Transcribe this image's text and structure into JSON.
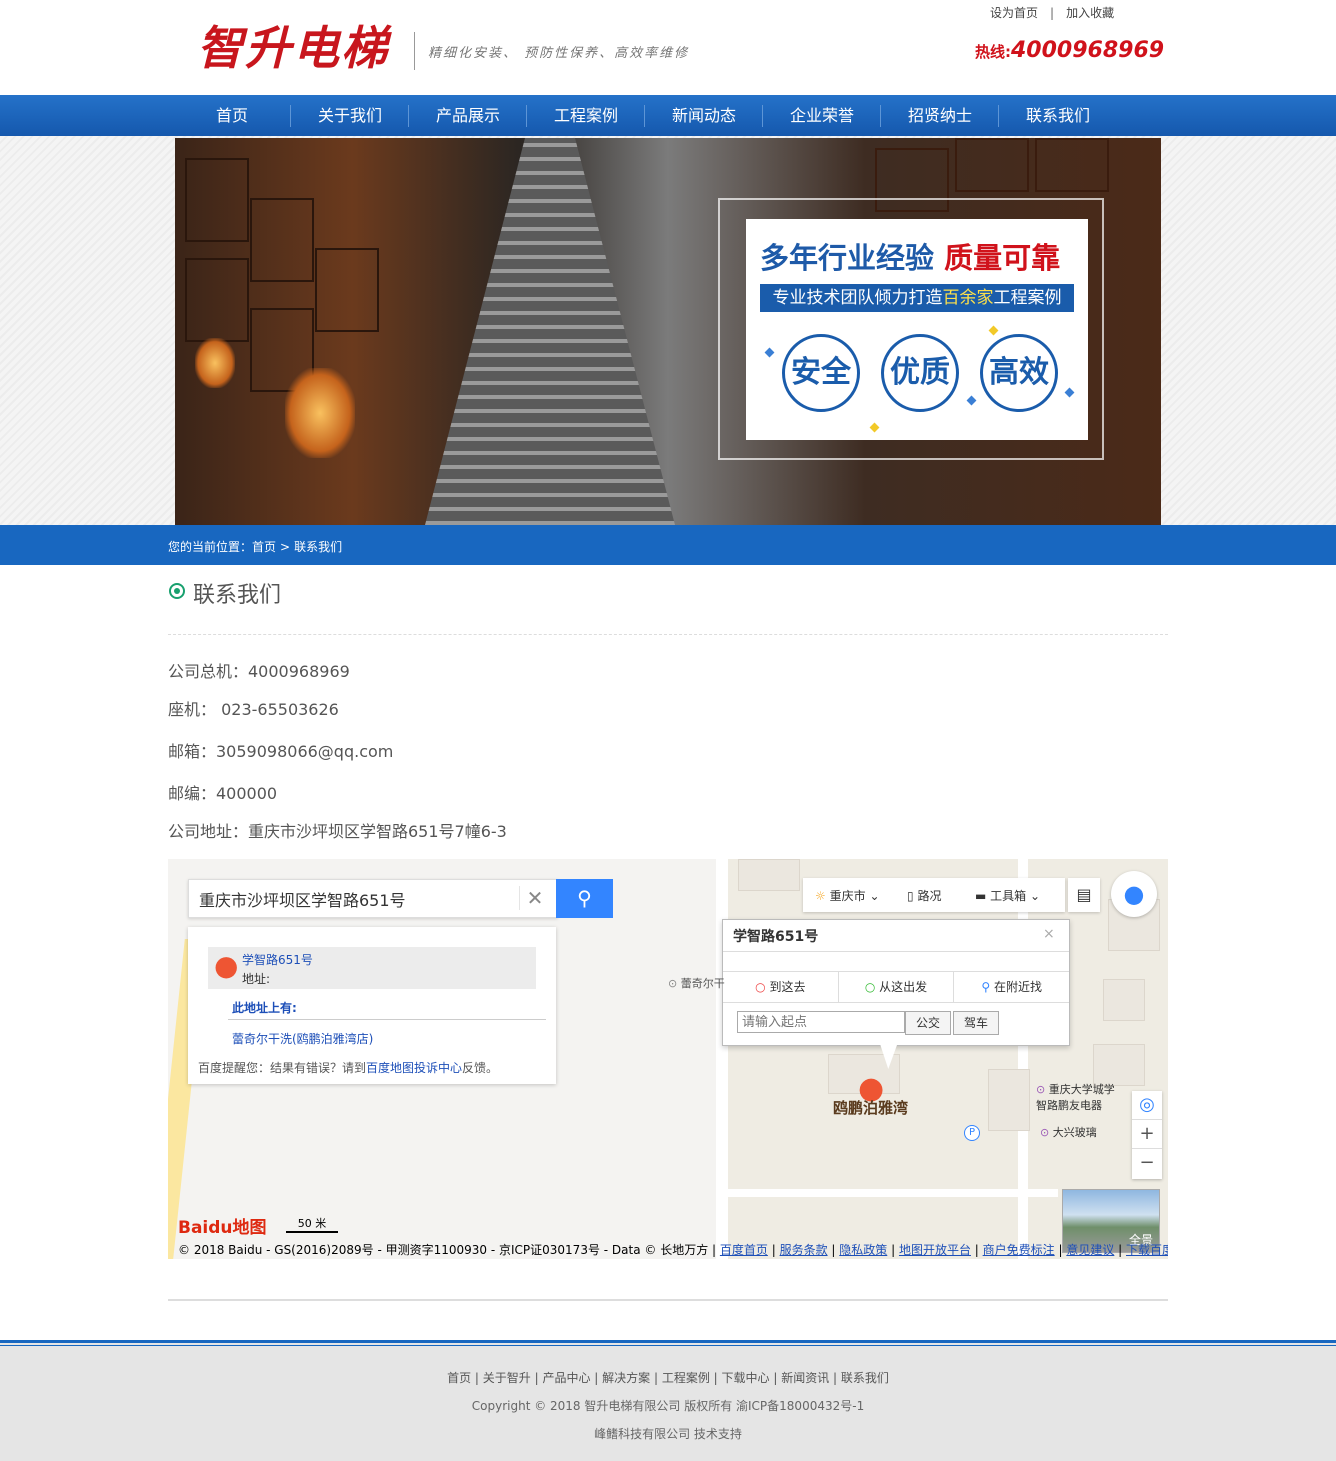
{
  "header": {
    "logo": "智升电梯",
    "slogan": "精细化安装、  预防性保养、高效率维修",
    "top_links": [
      "设为首页",
      "加入收藏"
    ],
    "top_link_sep": "|",
    "hotline_label": "热线:",
    "hotline_number": "4000968969"
  },
  "nav": {
    "items": [
      "首页",
      "关于我们",
      "产品展示",
      "工程案例",
      "新闻动态",
      "企业荣誉",
      "招贤纳士",
      "联系我们"
    ]
  },
  "banner": {
    "title_blue": "多年行业经验",
    "title_red": "质量可靠",
    "subtitle_a": "专业技术团队倾力打造",
    "subtitle_hl": "百余家",
    "subtitle_b": "工程案例",
    "badges": [
      "安全",
      "优质",
      "高效"
    ]
  },
  "breadcrumb": {
    "label": "您的当前位置：",
    "home": "首页",
    "sep": ">",
    "current": "联系我们"
  },
  "content": {
    "title": "联系我们",
    "phone": "公司总机：4000968969",
    "landline": "座机： 023-65503626",
    "email": "邮箱：3059098066@qq.com",
    "postcode": "邮编：400000",
    "address": "公司地址：重庆市沙坪坝区学智路651号7幢6-3"
  },
  "map": {
    "search_value": "重庆市沙坪坝区学智路651号",
    "result_title": "学智路651号",
    "result_addr": "地址:",
    "result_section": "此地址上有:",
    "result_poi": "蕾奇尔干洗(鸥鹏泊雅湾店)",
    "result_tip_a": "百度提醒您：结果有错误？请到",
    "result_tip_link": "百度地图投诉中心",
    "result_tip_b": "反馈。",
    "toolbar": {
      "city": "重庆市",
      "traffic": "路况",
      "tools": "工具箱"
    },
    "popup": {
      "title": "学智路651号",
      "tabs": [
        "到这去",
        "从这出发",
        "在附近找"
      ],
      "input_placeholder": "请输入起点",
      "btn_bus": "公交",
      "btn_drive": "驾车"
    },
    "labels": {
      "poi_left": "蕾奇尔干",
      "estate": "鸥鹏泊雅湾",
      "uni": "重庆大学城学智路鹏友电器",
      "glass": "大兴玻璃",
      "pano": "全景"
    },
    "logo": "Baidu地图",
    "scale": "50 米",
    "copyright": "© 2018 Baidu - GS(2016)2089号 - 甲测资字1100930 - 京ICP证030173号 - Data © 长地万方 |",
    "footer_links": [
      "百度首页",
      "服务条款",
      "隐私政策",
      "地图开放平台",
      "商户免费标注",
      "意见建议",
      "下载百度地图"
    ]
  },
  "footer": {
    "nav": [
      "首页",
      "关于智升",
      "产品中心",
      "解决方案",
      "工程案例",
      "下载中心",
      "新闻资讯",
      "联系我们"
    ],
    "copyright": "Copyright © 2018 智升电梯有限公司 版权所有 渝ICP备18000432号-1",
    "tech": "峰鳍科技有限公司 技术支持"
  },
  "colors": {
    "brand_red": "#c8161d",
    "nav_blue": "#1867c0",
    "map_blue": "#3385ff"
  }
}
